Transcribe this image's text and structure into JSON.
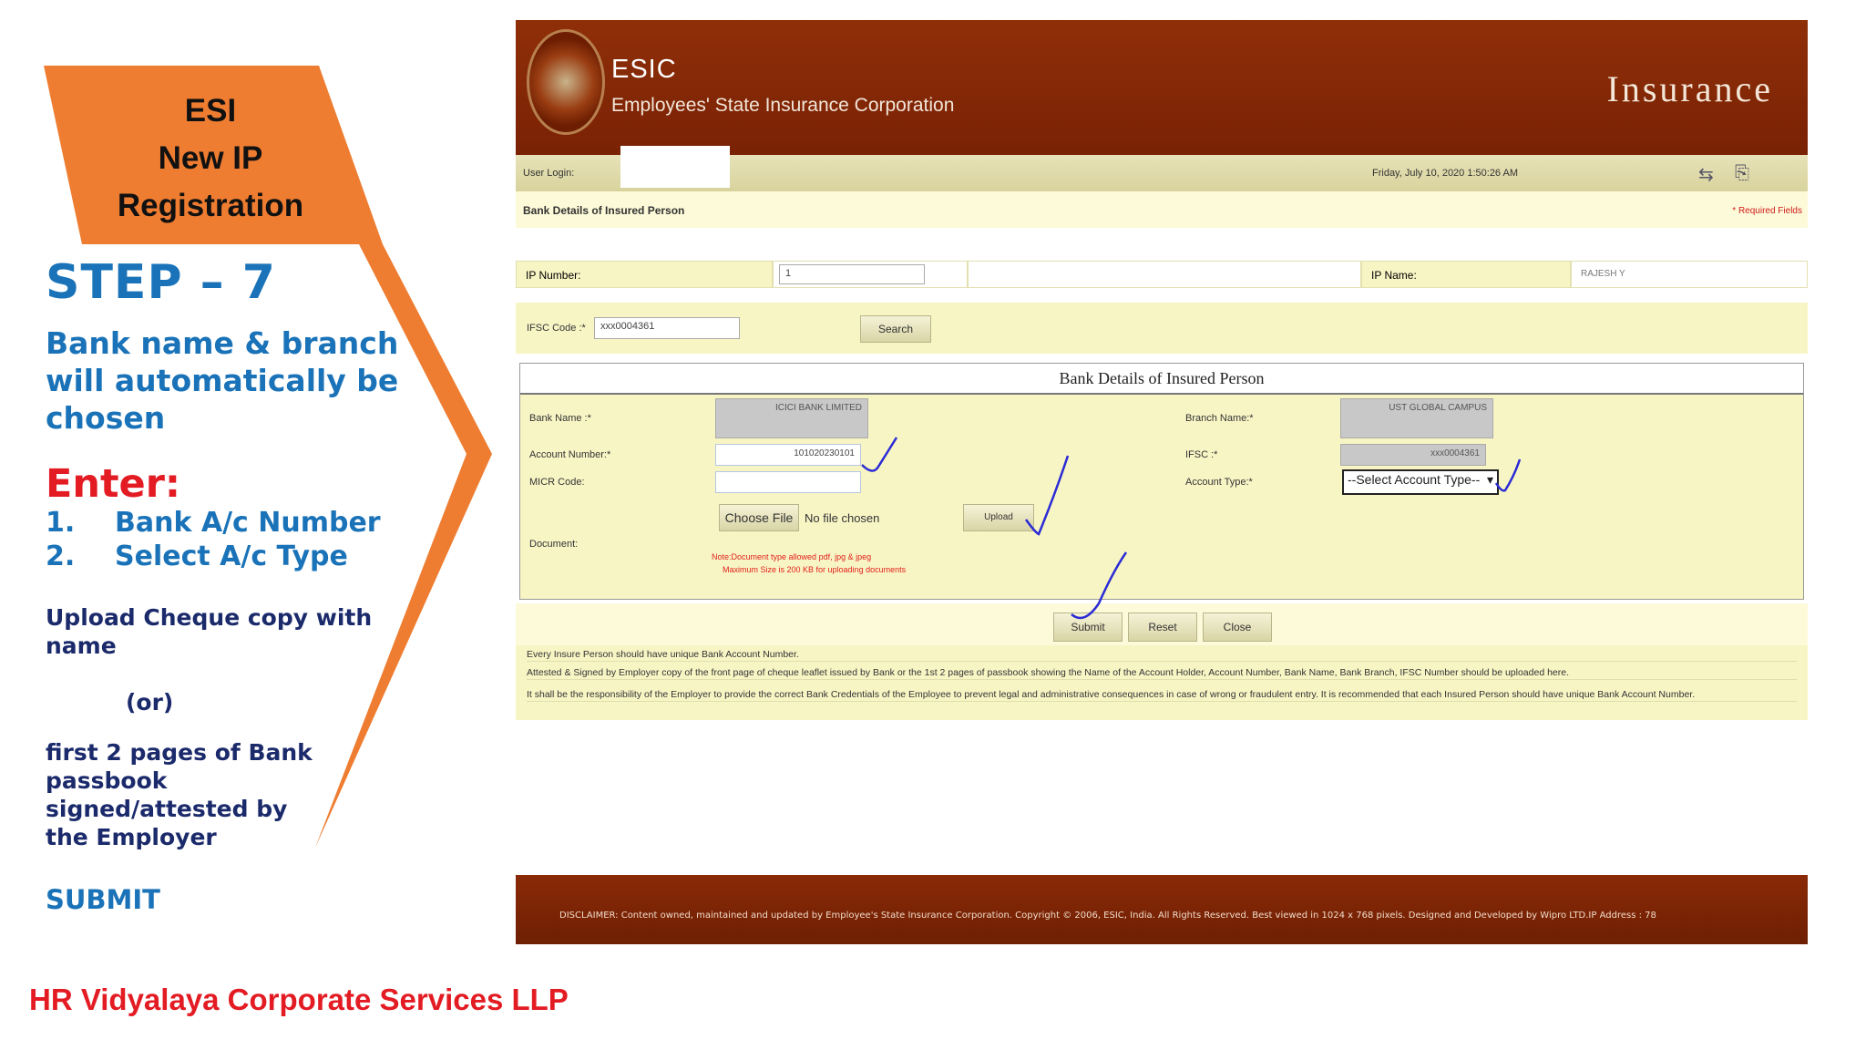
{
  "slide": {
    "title_lines": [
      "ESI",
      "New IP",
      "Registration"
    ],
    "step": "STEP – 7",
    "auto_note": "Bank name & branch will automatically be chosen",
    "enter_label": "Enter:",
    "enter_items": [
      {
        "num": "1.",
        "text": "Bank A/c Number"
      },
      {
        "num": "2.",
        "text": "Select A/c Type"
      }
    ],
    "upload_note": "Upload Cheque copy with name",
    "or_note": "(or)",
    "passbook_note": "first 2 pages of Bank passbook signed/attested by the Employer",
    "submit_note": "SUBMIT",
    "company": "HR Vidyalaya Corporate Services LLP",
    "colors": {
      "orange": "#ee7d31",
      "blue": "#1a73b8",
      "red": "#e31b23",
      "navy": "#1b2a6b"
    }
  },
  "esic": {
    "logo_text": "ESIC",
    "org_name": "Employees' State Insurance Corporation",
    "right_title": "Insurance",
    "user_login_label": "User Login:",
    "date_text": "Friday, July 10, 2020 1:50:26 AM",
    "section_title": "Bank Details of Insured Person",
    "required_note": "* Required Fields",
    "ip_number_label": "IP Number:",
    "ip_number_value": "1",
    "ip_name_label": "IP Name:",
    "ip_name_value": "RAJESH Y",
    "ifsc_label": "IFSC Code :*",
    "ifsc_value": "xxx0004361",
    "search_button": "Search",
    "bank_box_title": "Bank Details of Insured Person",
    "bank_name_label": "Bank Name :*",
    "bank_name_value": "ICICI BANK LIMITED",
    "branch_label": "Branch Name:*",
    "branch_value": "UST GLOBAL CAMPUS",
    "account_label": "Account Number:*",
    "account_value": "101020230101",
    "ifsc2_label": "IFSC :*",
    "ifsc2_value": "xxx0004361",
    "micr_label": "MICR Code:",
    "account_type_label": "Account Type:*",
    "account_type_value": "--Select Account Type--",
    "document_label": "Document:",
    "choose_file": "Choose File",
    "no_file": "No file chosen",
    "upload_button": "Upload",
    "warn_line1": "Note:Document type allowed pdf, jpg & jpeg",
    "warn_line2": "Maximum Size is 200 KB for uploading documents",
    "submit_button": "Submit",
    "reset_button": "Reset",
    "close_button": "Close",
    "notes": [
      "Every Insure Person should have unique Bank Account Number.",
      "Attested & Signed by Employer copy of the front page of cheque leaflet issued by Bank or the 1st 2 pages of passbook showing the Name of the Account Holder, Account Number, Bank Name, Bank Branch, IFSC Number should be uploaded here.",
      "It shall be the responsibility of the Employer to provide the correct Bank Credentials of the Employee to prevent legal and administrative consequences in case of wrong or fraudulent entry. It is recommended that each Insured Person should have unique Bank Account Number."
    ],
    "footer": "DISCLAIMER: Content owned, maintained and updated by Employee's State Insurance Corporation. Copyright © 2006, ESIC, India. All Rights Reserved. Best viewed in 1024 x 768 pixels. Designed and Developed by Wipro LTD.IP Address : 78",
    "colors": {
      "header": "#7a2205",
      "form_bg": "#f8f5c5",
      "tick": "#2b2bd6"
    }
  }
}
